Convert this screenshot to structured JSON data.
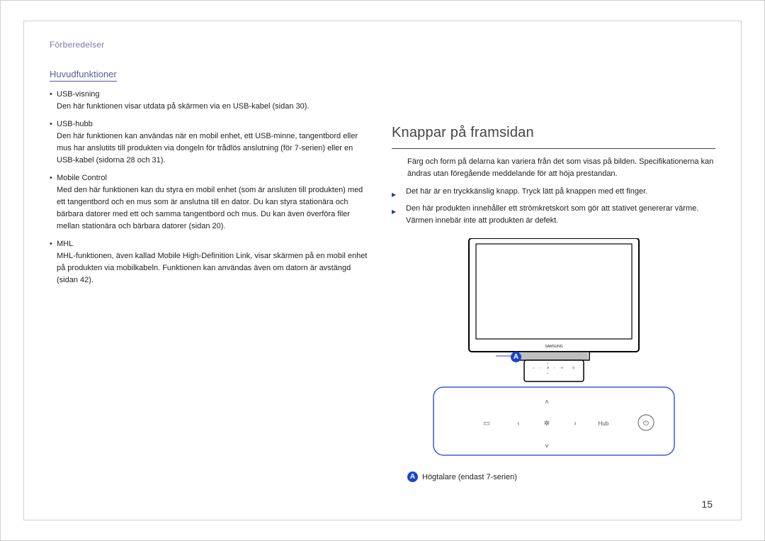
{
  "breadcrumb": "Förberedelser",
  "left": {
    "heading": "Huvudfunktioner",
    "items": [
      {
        "label": "USB-visning",
        "desc": "Den här funktionen visar utdata på skärmen via en USB-kabel (sidan 30)."
      },
      {
        "label": "USB-hubb",
        "desc": "Den här funktionen kan användas när en mobil enhet, ett USB-minne, tangentbord eller mus har anslutits till produkten via dongeln för trådlös anslutning (för 7-serien) eller en USB-kabel (sidorna 28 och 31)."
      },
      {
        "label": "Mobile Control",
        "desc": "Med den här funktionen kan du styra en mobil enhet (som är ansluten till produkten) med ett tangentbord och en mus som är anslutna till en dator. Du kan styra stationära och bärbara datorer med ett och samma tangentbord och mus. Du kan även överföra filer mellan stationära och bärbara datorer (sidan 20)."
      },
      {
        "label": "MHL",
        "desc": "MHL-funktionen, även kallad Mobile High-Definition Link, visar skärmen på en mobil enhet på produkten via mobilkabeln. Funktionen kan användas även om datorn är avstängd (sidan 42)."
      }
    ]
  },
  "right": {
    "title": "Knappar på framsidan",
    "note": "Färg och form på delarna kan variera från det som visas på bilden. Specifikationerna kan ändras utan föregående meddelande för att höja prestandan.",
    "bullets": [
      "Det här är en tryckkänslig knapp. Tryck lätt på knappen med ett finger.",
      "Den här produkten innehåller ett strömkretskort som gör att stativet genererar värme. Värmen innebär inte att produkten är defekt."
    ],
    "marker": "A",
    "legend": "Högtalare (endast 7-serien)",
    "monitor_brand": "SAMSUNG",
    "panel_buttons": {
      "up": "˄",
      "down": "˅",
      "left": "‹",
      "right": "›",
      "menu": "▭",
      "enter": "✲",
      "hub": "Hub",
      "power": "⏻"
    }
  },
  "page_number": "15"
}
